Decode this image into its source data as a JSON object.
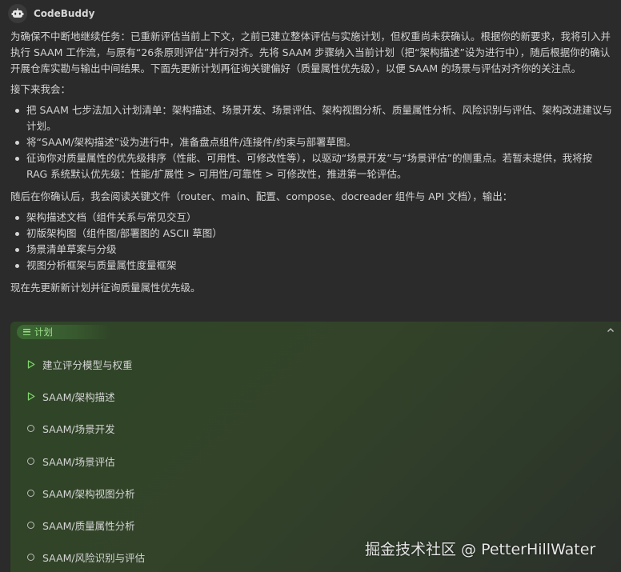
{
  "header": {
    "agent_name": "CodeBuddy",
    "avatar_icon": "robot-avatar-icon"
  },
  "message": {
    "intro": "为确保不中断地继续任务：已重新评估当前上下文，之前已建立整体评估与实施计划，但权重尚未获确认。根据你的新要求，我将引入并执行 SAAM 工作流，与原有“26条原则评估”并行对齐。先将 SAAM 步骤纳入当前计划（把“架构描述”设为进行中），随后根据你的确认开展仓库实勘与输出中间结果。下面先更新计划再征询关键偏好（质量属性优先级），以便 SAAM 的场景与评估对齐你的关注点。",
    "next_heading": "接下来我会：",
    "next_items": [
      "把 SAAM 七步法加入计划清单：架构描述、场景开发、场景评估、架构视图分析、质量属性分析、风险识别与评估、架构改进建议与计划。",
      "将“SAAM/架构描述”设为进行中，准备盘点组件/连接件/约束与部署草图。",
      "征询你对质量属性的优先级排序（性能、可用性、可修改性等），以驱动“场景开发”与“场景评估”的侧重点。若暂未提供，我将按 RAG 系统默认优先级：性能/扩展性 > 可用性/可靠性 > 可修改性，推进第一轮评估。"
    ],
    "after_heading": "随后在你确认后，我会阅读关键文件（router、main、配置、compose、docreader 组件与 API 文档），输出：",
    "after_items": [
      "架构描述文档（组件关系与常见交互）",
      "初版架构图（组件图/部署图的 ASCII 草图）",
      "场景清单草案与分级",
      "视图分析框架与质量属性度量框架"
    ],
    "closing": "现在先更新新计划并征询质量属性优先级。"
  },
  "plan": {
    "tab_label": "计划",
    "tab_icon": "list-icon",
    "collapse_icon": "chevron-up-icon",
    "accent": "#9be08a",
    "steps": [
      {
        "label": "建立评分模型与权重",
        "status": "in-progress",
        "icon": "play-triangle-icon"
      },
      {
        "label": "SAAM/架构描述",
        "status": "in-progress",
        "icon": "play-triangle-icon"
      },
      {
        "label": "SAAM/场景开发",
        "status": "pending",
        "icon": "circle-icon"
      },
      {
        "label": "SAAM/场景评估",
        "status": "pending",
        "icon": "circle-icon"
      },
      {
        "label": "SAAM/架构视图分析",
        "status": "pending",
        "icon": "circle-icon"
      },
      {
        "label": "SAAM/质量属性分析",
        "status": "pending",
        "icon": "circle-icon"
      },
      {
        "label": "SAAM/风险识别与评估",
        "status": "pending",
        "icon": "circle-icon"
      }
    ]
  },
  "watermark": "掘金技术社区 @ PetterHillWater"
}
